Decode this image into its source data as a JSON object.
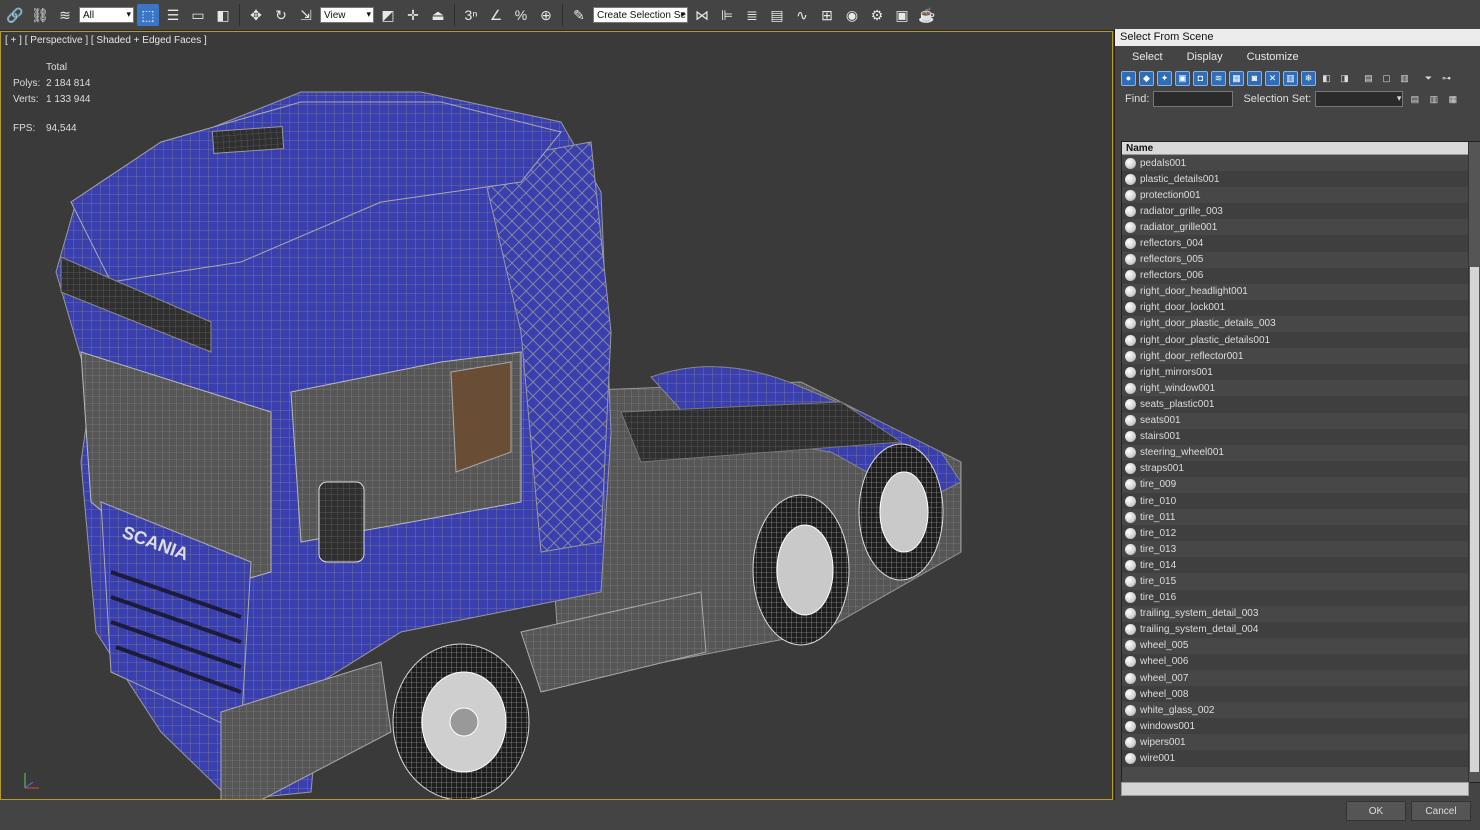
{
  "toolbar": {
    "filter_value": "All",
    "refcoord_value": "View",
    "selection_set_placeholder": "Create Selection Se"
  },
  "viewport": {
    "label": "[ + ] [ Perspective ] [ Shaded + Edged Faces ]",
    "stats": {
      "total_label": "Total",
      "polys_label": "Polys:",
      "polys_value": "2 184 814",
      "verts_label": "Verts:",
      "verts_value": "1 133 944",
      "fps_label": "FPS:",
      "fps_value": "94,544"
    },
    "model_color": "#3a3fb0",
    "wire_color": "#8c8c8c"
  },
  "dialog": {
    "title": "Select From Scene",
    "menu": [
      "Select",
      "Display",
      "Customize"
    ],
    "find_label": "Find:",
    "selection_set_label": "Selection Set:",
    "column_header": "Name",
    "items": [
      "pedals001",
      "plastic_details001",
      "protection001",
      "radiator_grille_003",
      "radiator_grille001",
      "reflectors_004",
      "reflectors_005",
      "reflectors_006",
      "right_door_headlight001",
      "right_door_lock001",
      "right_door_plastic_details_003",
      "right_door_plastic_details001",
      "right_door_reflector001",
      "right_mirrors001",
      "right_window001",
      "seats_plastic001",
      "seats001",
      "stairs001",
      "steering_wheel001",
      "straps001",
      "tire_009",
      "tire_010",
      "tire_011",
      "tire_012",
      "tire_013",
      "tire_014",
      "tire_015",
      "tire_016",
      "trailing_system_detail_003",
      "trailing_system_detail_004",
      "wheel_005",
      "wheel_006",
      "wheel_007",
      "wheel_008",
      "white_glass_002",
      "windows001",
      "wipers001",
      "wire001"
    ],
    "ok_label": "OK",
    "cancel_label": "Cancel"
  }
}
